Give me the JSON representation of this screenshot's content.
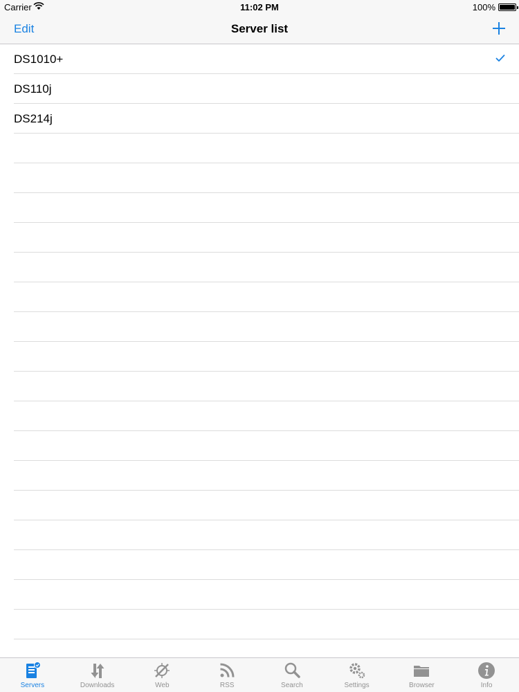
{
  "status_bar": {
    "carrier": "Carrier",
    "time": "11:02 PM",
    "battery": "100%"
  },
  "nav_bar": {
    "edit_label": "Edit",
    "title": "Server list",
    "add_icon": "plus-icon"
  },
  "servers": [
    {
      "name": "DS1010+",
      "selected": true
    },
    {
      "name": "DS110j",
      "selected": false
    },
    {
      "name": "DS214j",
      "selected": false
    }
  ],
  "tab_bar": {
    "active": "Servers",
    "tabs": [
      {
        "label": "Servers",
        "icon": "server-icon"
      },
      {
        "label": "Downloads",
        "icon": "downloads-icon"
      },
      {
        "label": "Web",
        "icon": "web-icon"
      },
      {
        "label": "RSS",
        "icon": "rss-icon"
      },
      {
        "label": "Search",
        "icon": "search-icon"
      },
      {
        "label": "Settings",
        "icon": "settings-icon"
      },
      {
        "label": "Browser",
        "icon": "folder-icon"
      },
      {
        "label": "Info",
        "icon": "info-icon"
      }
    ]
  },
  "colors": {
    "accent": "#1a82e2",
    "inactive": "#929292",
    "separator": "#dcdcdc",
    "bar_background": "#f7f7f7"
  }
}
